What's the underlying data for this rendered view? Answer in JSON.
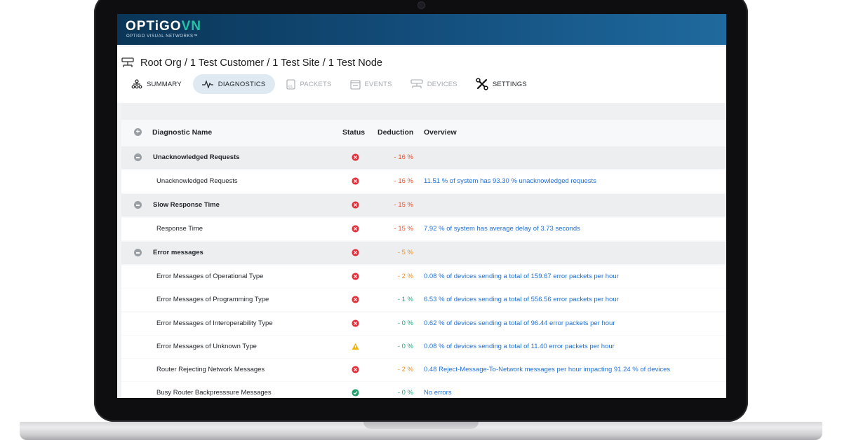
{
  "brand": {
    "name_main": "OPTiGO",
    "name_accent": "VN",
    "tagline": "OPTIGO VISUAL NETWORKS™"
  },
  "breadcrumb": "Root Org / 1 Test Customer / 1 Test Site / 1 Test Node",
  "tabs": [
    {
      "label": "SUMMARY",
      "icon": "hierarchy-icon",
      "state": "normal"
    },
    {
      "label": "DIAGNOSTICS",
      "icon": "pulse-icon",
      "state": "active"
    },
    {
      "label": "PACKETS",
      "icon": "packet-icon",
      "state": "disabled"
    },
    {
      "label": "EVENTS",
      "icon": "calendar-icon",
      "state": "disabled"
    },
    {
      "label": "DEVICES",
      "icon": "device-icon",
      "state": "disabled"
    },
    {
      "label": "SETTINGS",
      "icon": "tools-icon",
      "state": "normal"
    }
  ],
  "table": {
    "headers": {
      "name": "Diagnostic Name",
      "status": "Status",
      "deduction": "Deduction",
      "overview": "Overview"
    },
    "rows": [
      {
        "type": "group",
        "name": "Unacknowledged Requests",
        "status": "error",
        "deduction": "- 16 %",
        "overview": ""
      },
      {
        "type": "child",
        "name": "Unacknowledged Requests",
        "status": "error",
        "deduction": "- 16 %",
        "overview": "11.51 % of system has 93.30 % unacknowledged requests"
      },
      {
        "type": "group",
        "name": "Slow Response Time",
        "status": "error",
        "deduction": "- 15 %",
        "overview": ""
      },
      {
        "type": "child",
        "name": "Response Time",
        "status": "error",
        "deduction": "- 15 %",
        "overview": "7.92 % of system has average delay of 3.73 seconds"
      },
      {
        "type": "group",
        "name": "Error messages",
        "status": "error",
        "deduction": "- 5 %",
        "overview": ""
      },
      {
        "type": "child",
        "name": "Error Messages of Operational Type",
        "status": "error",
        "deduction": "- 2 %",
        "overview": "0.08 % of devices sending a total of 159.67 error packets per hour"
      },
      {
        "type": "child",
        "name": "Error Messages of Programming Type",
        "status": "error",
        "deduction": "- 1 %",
        "overview": "6.53 % of devices sending a total of 556.56 error packets per hour"
      },
      {
        "type": "child",
        "name": "Error Messages of Interoperability Type",
        "status": "error",
        "deduction": "- 0 %",
        "overview": "0.62 % of devices sending a total of 96.44 error packets per hour"
      },
      {
        "type": "child",
        "name": "Error Messages of Unknown Type",
        "status": "warning",
        "deduction": "- 0 %",
        "overview": "0.08 % of devices sending a total of 11.40 error packets per hour"
      },
      {
        "type": "child",
        "name": "Router Rejecting Network Messages",
        "status": "error",
        "deduction": "- 2 %",
        "overview": "0.48 Reject-Message-To-Network messages per hour impacting 91.24 % of devices"
      },
      {
        "type": "child",
        "name": "Busy Router Backpresssure Messages",
        "status": "ok",
        "deduction": "- 0 %",
        "overview": "No errors"
      }
    ]
  },
  "colors": {
    "deduction_high": "#e2502b",
    "deduction_mid": "#ee8a1f",
    "deduction_low": "#1ba37a",
    "status_error": "#e0313a",
    "status_warning": "#f5b400",
    "status_ok": "#22a06b",
    "link": "#1f6fd6"
  }
}
